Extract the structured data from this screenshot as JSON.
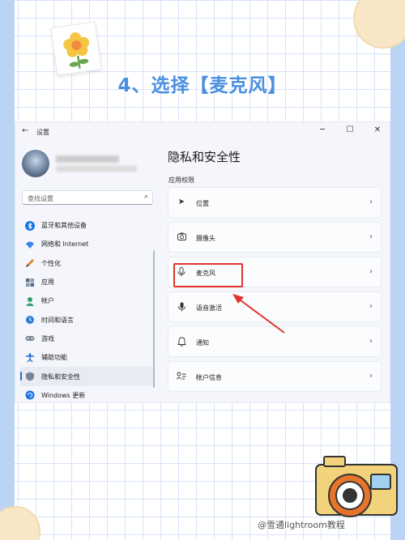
{
  "title": "4、选择【麦克风】",
  "window": {
    "app_title": "设置",
    "controls": {
      "minimize": "─",
      "maximize": "☐",
      "close": "✕"
    }
  },
  "search": {
    "placeholder": "查找设置"
  },
  "sidebar": {
    "items": [
      {
        "label": "蓝牙和其他设备",
        "icon": "bluetooth-icon"
      },
      {
        "label": "网络和 Internet",
        "icon": "wifi-icon"
      },
      {
        "label": "个性化",
        "icon": "brush-icon"
      },
      {
        "label": "应用",
        "icon": "apps-icon"
      },
      {
        "label": "帐户",
        "icon": "person-icon"
      },
      {
        "label": "时间和语言",
        "icon": "globe-clock-icon"
      },
      {
        "label": "游戏",
        "icon": "gamepad-icon"
      },
      {
        "label": "辅助功能",
        "icon": "accessibility-icon"
      },
      {
        "label": "隐私和安全性",
        "icon": "shield-icon",
        "active": true
      },
      {
        "label": "Windows 更新",
        "icon": "update-icon"
      }
    ]
  },
  "content": {
    "title": "隐私和安全性",
    "section_label": "应用权限",
    "rows": [
      {
        "label": "位置",
        "icon": "location-icon"
      },
      {
        "label": "摄像头",
        "icon": "camera-icon"
      },
      {
        "label": "麦克风",
        "icon": "microphone-icon"
      },
      {
        "label": "语音激活",
        "icon": "voice-icon"
      },
      {
        "label": "通知",
        "icon": "bell-icon"
      },
      {
        "label": "帐户信息",
        "icon": "account-info-icon"
      }
    ]
  },
  "watermark": "@雪通lightroom教程",
  "colors": {
    "title": "#4b8fe0",
    "accent": "#1f6fd0",
    "highlight": "#e0342c",
    "grid": "#d6e4f8",
    "side_strip": "#bcd4f4"
  }
}
